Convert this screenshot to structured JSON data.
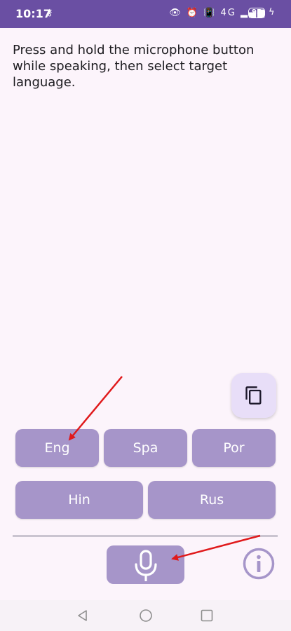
{
  "status_bar": {
    "time": "10:17",
    "key_icon": "vpn-key-icon",
    "icons": "👁 ⏰ 📳 4G ▂▄▆",
    "battery": "95",
    "charging_icon": "bolt-icon",
    "color": "#6a4fa3"
  },
  "instruction": "Press and hold the microphone button while speaking, then select target language.",
  "copy_button": {
    "icon": "content-copy-icon",
    "color": "#e8def8"
  },
  "languages": {
    "eng": "Eng",
    "spa": "Spa",
    "por": "Por",
    "hin": "Hin",
    "rus": "Rus"
  },
  "mic_button": {
    "icon": "microphone-icon",
    "color": "#a695c9"
  },
  "info_button": {
    "icon": "info-icon",
    "color": "#a695c9"
  },
  "nav_bar": {
    "back": "back-icon",
    "home": "home-icon",
    "recents": "recents-icon"
  },
  "annotation_color": "#e0191b",
  "background": "#fcf4fb"
}
